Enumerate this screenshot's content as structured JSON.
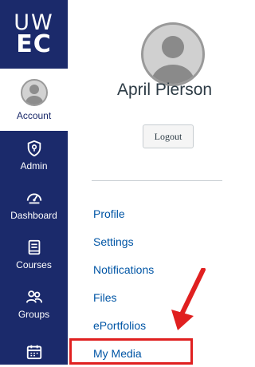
{
  "logo": {
    "line1": "UW",
    "line2": "EC"
  },
  "nav": {
    "account_label": "Account",
    "items": [
      {
        "label": "Admin",
        "icon": "shield-icon"
      },
      {
        "label": "Dashboard",
        "icon": "speedometer-icon"
      },
      {
        "label": "Courses",
        "icon": "book-icon"
      },
      {
        "label": "Groups",
        "icon": "groups-icon"
      },
      {
        "label": "",
        "icon": "calendar-icon"
      }
    ]
  },
  "profile": {
    "name": "April Pierson",
    "logout_label": "Logout"
  },
  "links": [
    "Profile",
    "Settings",
    "Notifications",
    "Files",
    "ePortfolios",
    "My Media"
  ],
  "colors": {
    "nav_bg": "#1b2a6b",
    "link": "#0055a5",
    "highlight": "#e02020"
  }
}
